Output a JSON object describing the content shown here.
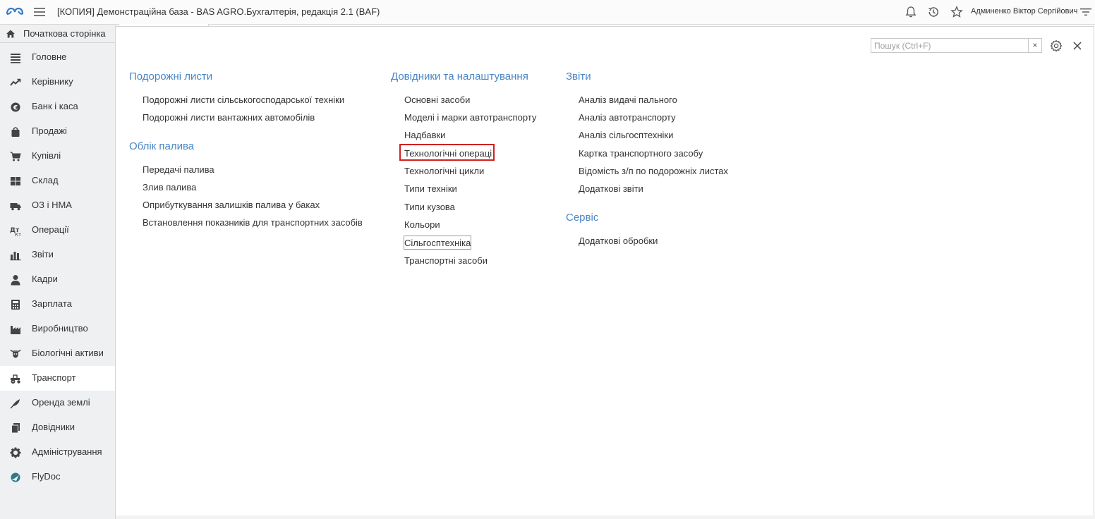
{
  "header": {
    "title": "[КОПИЯ] Демонстраційна база - BAS AGRO.Бухгалтерія, редакція 2.1  (BAF)",
    "user_name": "Админенко Віктор Сергійович"
  },
  "sidebar": {
    "home": "Початкова сторінка",
    "items": [
      {
        "label": "Головне",
        "icon": "list-icon"
      },
      {
        "label": "Керівнику",
        "icon": "trend-icon"
      },
      {
        "label": "Банк і каса",
        "icon": "coin-icon"
      },
      {
        "label": "Продажі",
        "icon": "bag-icon"
      },
      {
        "label": "Купівлі",
        "icon": "cart-icon"
      },
      {
        "label": "Склад",
        "icon": "warehouse-icon"
      },
      {
        "label": "ОЗ і НМА",
        "icon": "truck-icon"
      },
      {
        "label": "Операції",
        "icon": "operations-icon"
      },
      {
        "label": "Звіти",
        "icon": "bar-chart-icon"
      },
      {
        "label": "Кадри",
        "icon": "person-icon"
      },
      {
        "label": "Зарплата",
        "icon": "calculator-icon"
      },
      {
        "label": "Виробництво",
        "icon": "factory-icon"
      },
      {
        "label": "Біологічні активи",
        "icon": "cow-icon"
      },
      {
        "label": "Транспорт",
        "icon": "tractor-icon"
      },
      {
        "label": "Оренда землі",
        "icon": "feather-icon"
      },
      {
        "label": "Довідники",
        "icon": "books-icon"
      },
      {
        "label": "Адміністрування",
        "icon": "gear-icon"
      },
      {
        "label": "FlyDoc",
        "icon": "flydoc-icon"
      }
    ],
    "active": "Транспорт"
  },
  "search": {
    "placeholder": "Пошук (Ctrl+F)",
    "clear": "×"
  },
  "columns": {
    "waybills": {
      "title": "Подорожні листи",
      "links": [
        "Подорожні листи сільськогосподарської техніки",
        "Подорожні листи вантажних автомобілів"
      ]
    },
    "fuel": {
      "title": "Облік палива",
      "links": [
        "Передачі палива",
        "Злив палива",
        "Оприбуткування залишків палива у баках",
        "Встановлення показників для транспортних засобів"
      ]
    },
    "catalogs": {
      "title": "Довідники та налаштування",
      "links": [
        "Основні засоби",
        "Моделі і марки автотранспорту",
        "Надбавки",
        "Технологічні операції",
        "Технологічні цикли",
        "Типи техніки",
        "Типи кузова",
        "Кольори",
        "Сільгосптехніка",
        "Транспортні засоби"
      ]
    },
    "reports": {
      "title": "Звіти",
      "links": [
        "Аналіз видачі пального",
        "Аналіз автотранспорту",
        "Аналіз сільгосптехніки",
        "Картка транспортного засобу",
        "Відомість з/п по подорожніх листах",
        "Додаткові звіти"
      ]
    },
    "service": {
      "title": "Сервіс",
      "links": [
        "Додаткові обробки"
      ]
    }
  },
  "colors": {
    "accent": "#4a86c5",
    "highlight": "#d21f1f",
    "sidebar_bg": "#eef0f2"
  }
}
